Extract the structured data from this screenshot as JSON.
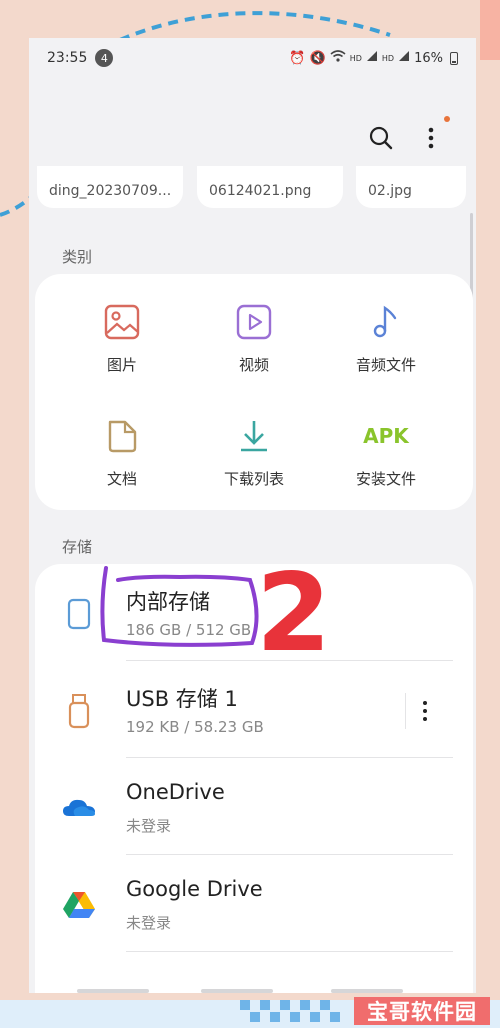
{
  "status_bar": {
    "time": "23:55",
    "notification_count": "4",
    "network_hd_1": "HD",
    "network_hd_2": "HD",
    "battery": "16%"
  },
  "recent_files": [
    "ding_20230709...",
    "06124021.png",
    "02.jpg"
  ],
  "categories": {
    "title": "类别",
    "items": [
      {
        "label": "图片",
        "icon": "image-icon",
        "color": "#d86a5e"
      },
      {
        "label": "视频",
        "icon": "video-icon",
        "color": "#9a6fd4"
      },
      {
        "label": "音频文件",
        "icon": "music-icon",
        "color": "#5b82d6"
      },
      {
        "label": "文档",
        "icon": "document-icon",
        "color": "#b89a66"
      },
      {
        "label": "下载列表",
        "icon": "download-icon",
        "color": "#3aa6a0"
      },
      {
        "label": "安装文件",
        "icon": "apk-icon",
        "icon_text": "APK",
        "color": "#8ac42c"
      }
    ]
  },
  "storage": {
    "title": "存储",
    "items": [
      {
        "title": "内部存储",
        "subtitle": "186 GB / 512 GB",
        "icon": "phone-icon"
      },
      {
        "title": "USB 存储 1",
        "subtitle": "192 KB / 58.23 GB",
        "icon": "usb-icon"
      },
      {
        "title": "OneDrive",
        "subtitle": "未登录",
        "icon": "onedrive-icon"
      },
      {
        "title": "Google Drive",
        "subtitle": "未登录",
        "icon": "google-drive-icon"
      }
    ]
  },
  "annotation": {
    "number": "2",
    "color": "#e8333a",
    "circle_color": "#8a3fd0"
  },
  "watermark": "宝哥软件园"
}
